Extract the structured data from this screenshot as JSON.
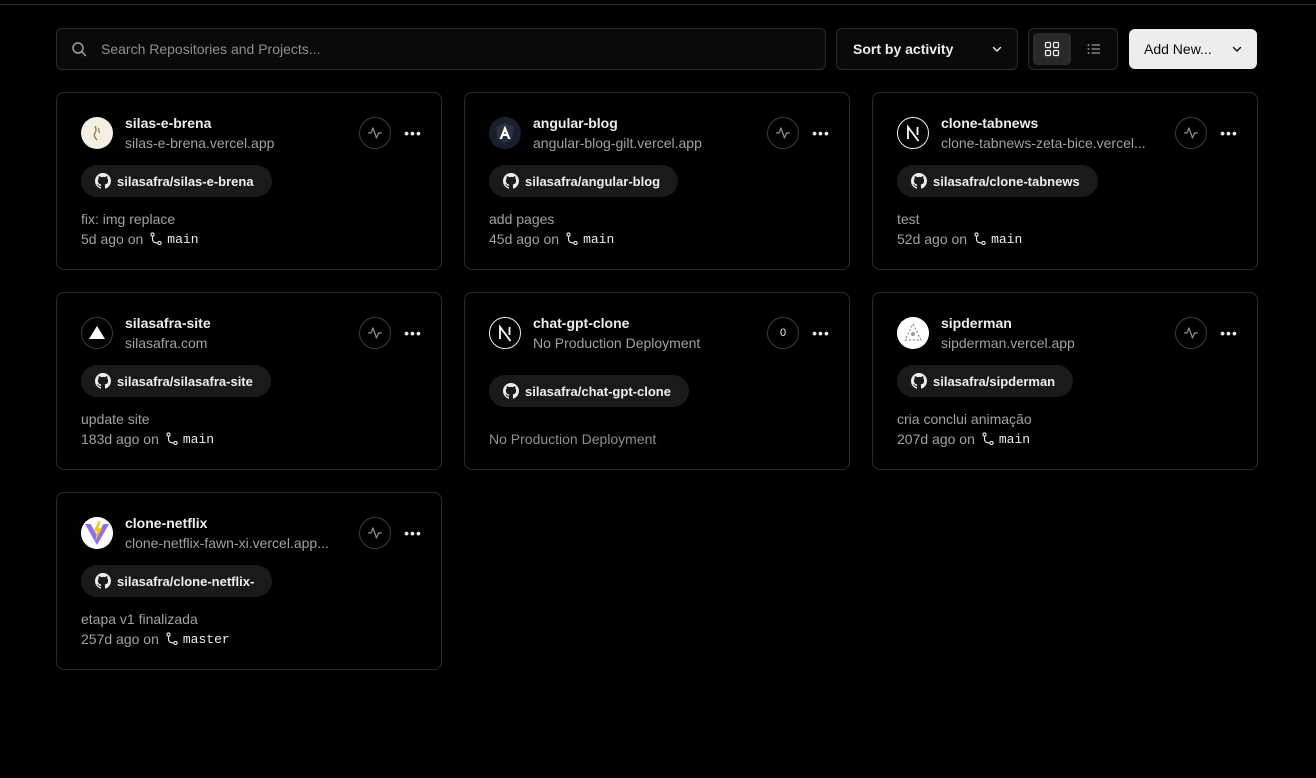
{
  "toolbar": {
    "search_placeholder": "Search Repositories and Projects...",
    "sort_label": "Sort by activity",
    "add_new_label": "Add New...",
    "view_mode": "grid"
  },
  "projects": [
    {
      "name": "silas-e-brena",
      "url": "silas-e-brena.vercel.app",
      "repo": "silasafra/silas-e-brena",
      "commit": "fix: img replace",
      "age": "5d ago on",
      "branch": "main"
    },
    {
      "name": "angular-blog",
      "url": "angular-blog-gilt.vercel.app",
      "repo": "silasafra/angular-blog",
      "commit": "add pages",
      "age": "45d ago on",
      "branch": "main"
    },
    {
      "name": "clone-tabnews",
      "url": "clone-tabnews-zeta-bice.vercel...",
      "repo": "silasafra/clone-tabnews",
      "commit": "test",
      "age": "52d ago on",
      "branch": "main"
    },
    {
      "name": "silasafra-site",
      "url": "silasafra.com",
      "repo": "silasafra/silasafra-site",
      "commit": "update site",
      "age": "183d ago on",
      "branch": "main"
    },
    {
      "name": "chat-gpt-clone",
      "url": "No Production Deployment",
      "repo": "silasafra/chat-gpt-clone",
      "deploy_status": "No Production Deployment",
      "activity_count": "0"
    },
    {
      "name": "sipderman",
      "url": "sipderman.vercel.app",
      "repo": "silasafra/sipderman",
      "commit": "cria conclui animação",
      "age": "207d ago on",
      "branch": "main"
    },
    {
      "name": "clone-netflix",
      "url": "clone-netflix-fawn-xi.vercel.app...",
      "repo": "silasafra/clone-netflix-",
      "commit": "etapa v1 finalizada",
      "age": "257d ago on",
      "branch": "master"
    }
  ],
  "icons": {
    "search": "search-icon",
    "chevron": "chevron-down-icon",
    "grid": "grid-view-icon",
    "list": "list-view-icon",
    "github": "github-icon",
    "branch": "git-branch-icon",
    "activity": "activity-pulse-icon",
    "more": "more-horizontal-icon"
  }
}
